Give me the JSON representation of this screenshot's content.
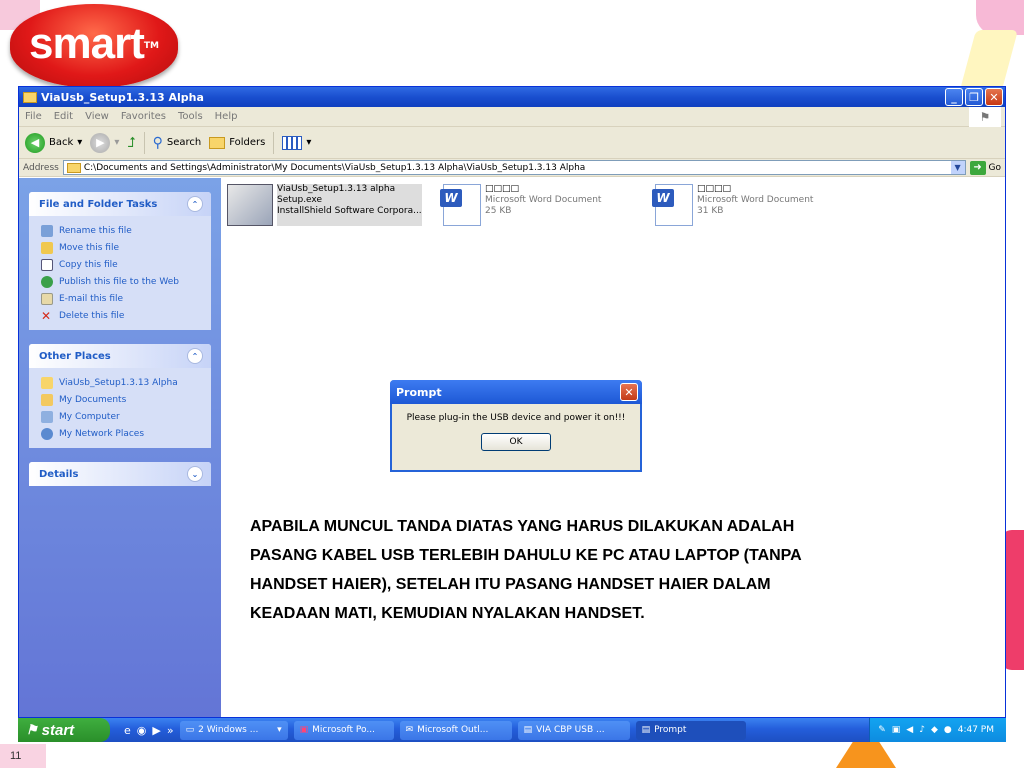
{
  "slide": {
    "number": "11"
  },
  "logo": {
    "text": "smart",
    "tm": "TM"
  },
  "window": {
    "title": "ViaUsb_Setup1.3.13 Alpha",
    "menu": [
      "File",
      "Edit",
      "View",
      "Favorites",
      "Tools",
      "Help"
    ],
    "toolbar": {
      "back": "Back",
      "search": "Search",
      "folders": "Folders"
    },
    "address": {
      "label": "Address",
      "value": "C:\\Documents and Settings\\Administrator\\My Documents\\ViaUsb_Setup1.3.13 Alpha\\ViaUsb_Setup1.3.13 Alpha",
      "go": "Go"
    }
  },
  "sidebar": {
    "file_tasks": {
      "title": "File and Folder Tasks",
      "items": [
        "Rename this file",
        "Move this file",
        "Copy this file",
        "Publish this file to the Web",
        "E-mail this file",
        "Delete this file"
      ]
    },
    "other_places": {
      "title": "Other Places",
      "items": [
        "ViaUsb_Setup1.3.13 Alpha",
        "My Documents",
        "My Computer",
        "My Network Places"
      ]
    },
    "details": {
      "title": "Details"
    }
  },
  "files": [
    {
      "line1": "ViaUsb_Setup1.3.13 alpha",
      "line2": "Setup.exe",
      "line3": "InstallShield Software Corpora..."
    },
    {
      "line1": "□□□□",
      "line2": "Microsoft Word Document",
      "line3": "25 KB"
    },
    {
      "line1": "□□□□",
      "line2": "Microsoft Word Document",
      "line3": "31 KB"
    }
  ],
  "dialog": {
    "title": "Prompt",
    "message": "Please plug-in the USB device and power it on!!!",
    "ok": "OK"
  },
  "note": "APABILA MUNCUL TANDA DIATAS YANG HARUS DILAKUKAN ADALAH PASANG KABEL USB TERLEBIH DAHULU KE PC ATAU LAPTOP (TANPA HANDSET HAIER), SETELAH ITU PASANG HANDSET HAIER DALAM KEADAAN MATI, KEMUDIAN NYALAKAN HANDSET.",
  "taskbar": {
    "start": "start",
    "tasks": [
      "2 Windows ...",
      "Microsoft Po...",
      "Microsoft Outl...",
      "VIA CBP USB ...",
      "Prompt"
    ],
    "clock": "4:47 PM"
  }
}
